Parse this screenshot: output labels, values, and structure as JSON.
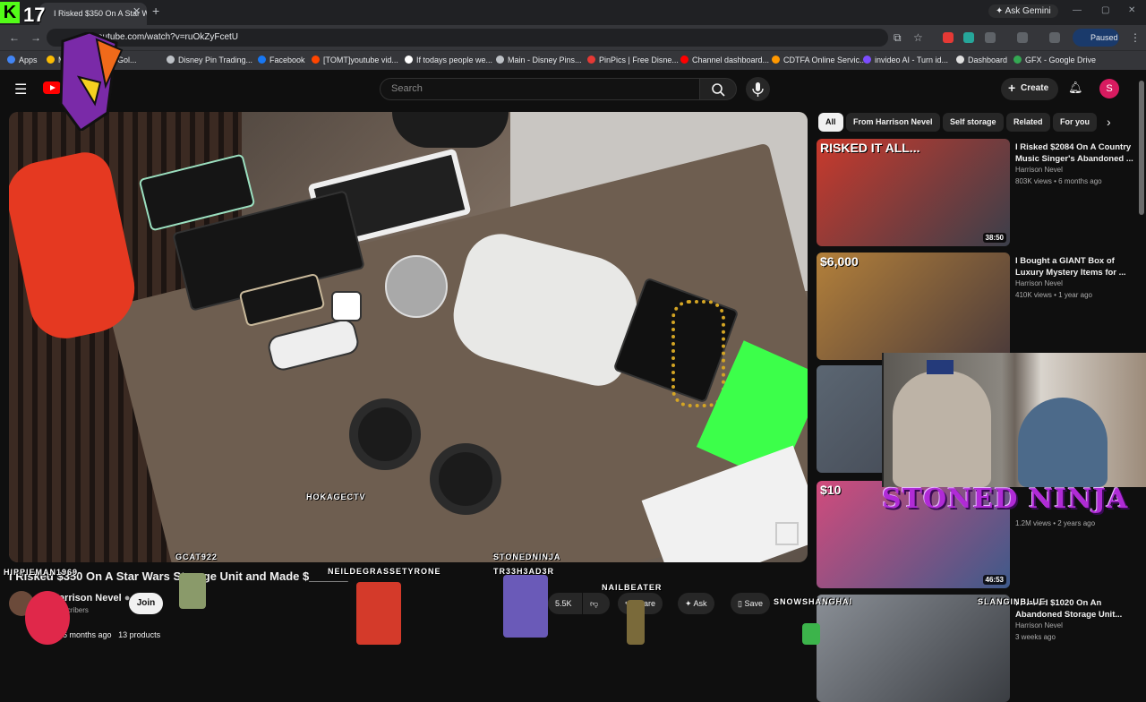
{
  "browser": {
    "tab_title": "I Risked $350 On A Star Wa",
    "ask_gemini": "Ask Gemini",
    "url": "youtube.com/watch?v=ruOkZyFcetU",
    "profile_status": "Paused",
    "bookmarks": [
      {
        "label": "Apps",
        "color": "#4285f4"
      },
      {
        "label": "Most Expensive Gol...",
        "color": "#fbbc04"
      },
      {
        "label": "Disney Pin Trading...",
        "color": "#bdc1c6"
      },
      {
        "label": "Facebook",
        "color": "#1877f2"
      },
      {
        "label": "[TOMT]youtube vid...",
        "color": "#ff4500"
      },
      {
        "label": "If todays people we...",
        "color": "#ffffff"
      },
      {
        "label": "Main - Disney Pins...",
        "color": "#bdc1c6"
      },
      {
        "label": "PinPics | Free Disne...",
        "color": "#e53935"
      },
      {
        "label": "Channel dashboard...",
        "color": "#ff0000"
      },
      {
        "label": "CDTFA Online Servic...",
        "color": "#ff9800"
      },
      {
        "label": "invideo AI - Turn id...",
        "color": "#7c4dff"
      },
      {
        "label": "Dashboard",
        "color": "#e0e0e0"
      },
      {
        "label": "GFX - Google Drive",
        "color": "#34a853"
      }
    ]
  },
  "youtube": {
    "search_placeholder": "Search",
    "create_label": "Create",
    "avatar_letter": "S"
  },
  "video": {
    "title": "I Risked $350 On A Star Wars Storage Unit and Made $______",
    "channel_name": "Harrison Nevel",
    "subscribers": "subscribers",
    "join_label": "Join",
    "likes": "5.5K",
    "share_label": "Share",
    "ask_label": "Ask",
    "save_label": "Save",
    "views_meta": "6 months ago",
    "products": "13 products"
  },
  "chips": [
    {
      "label": "All",
      "active": true
    },
    {
      "label": "From Harrison Nevel",
      "active": false
    },
    {
      "label": "Self storage",
      "active": false
    },
    {
      "label": "Related",
      "active": false
    },
    {
      "label": "For you",
      "active": false
    }
  ],
  "recommendations": [
    {
      "title": "I Risked $2084 On A Country Music Singer's Abandoned ...",
      "channel": "Harrison Nevel",
      "meta": "803K views • 6 months ago",
      "duration": "38:50",
      "thumb_text": "RISKED IT ALL...",
      "colors": [
        "#c9392c",
        "#3b3f4a"
      ]
    },
    {
      "title": "I Bought a GIANT Box of Luxury Mystery Items for ...",
      "channel": "Harrison Nevel",
      "meta": "410K views • 1 year ago",
      "duration": "",
      "thumb_text": "$6,000",
      "colors": [
        "#b3803a",
        "#4a3a3a"
      ]
    },
    {
      "title": "",
      "channel": "",
      "meta": "",
      "duration": "",
      "thumb_text": "",
      "colors": [
        "#5b6672",
        "#3b3f4a"
      ]
    },
    {
      "title": "",
      "channel": "",
      "meta": "1.2M views • 2 years ago",
      "duration": "46:53",
      "thumb_text": "$10",
      "colors": [
        "#d14b7c",
        "#3e5a8a"
      ]
    },
    {
      "title": "I Risked $1020 On An Abandoned Storage Unit...",
      "channel": "Harrison Nevel",
      "meta": "3 weeks ago",
      "duration": "",
      "thumb_text": "",
      "colors": [
        "#8a8f96",
        "#3a3d42"
      ]
    }
  ],
  "stream_overlay": {
    "counter": "17",
    "kick_badge": "K",
    "webcam_banner": "STONED NINJA",
    "names": [
      {
        "text": "HOKAGECTV"
      },
      {
        "text": "GCAT922"
      },
      {
        "text": "HIPPIEMAN1969"
      },
      {
        "text": "NEILDEGRASSETYRONE"
      },
      {
        "text": "STONEDNINJA"
      },
      {
        "text": "TR33H3AD3R"
      },
      {
        "text": "NAILBEATER"
      },
      {
        "text": "SNOWSHANGHAI"
      },
      {
        "text": "SLANGINBLUE"
      }
    ]
  }
}
